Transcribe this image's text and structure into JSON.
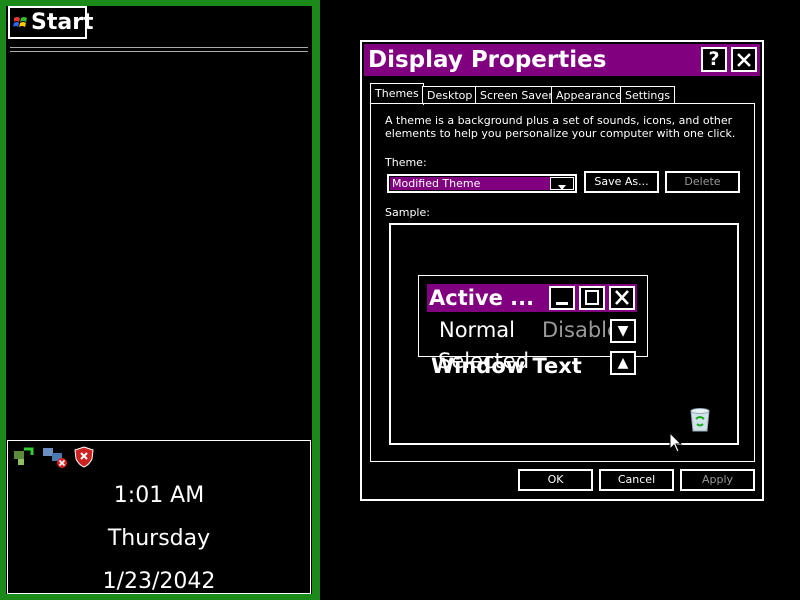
{
  "taskbar": {
    "start_label": "Start",
    "tray_icons": [
      "network-icon",
      "network-disconnected-icon",
      "security-alert-icon"
    ],
    "clock": {
      "time": "1:01 AM",
      "day": "Thursday",
      "date": "1/23/2042"
    }
  },
  "dialog": {
    "title": "Display Properties",
    "help_btn": "?",
    "close_btn": "✕",
    "tabs": [
      {
        "label": "Themes",
        "active": true
      },
      {
        "label": "Desktop"
      },
      {
        "label": "Screen Saver"
      },
      {
        "label": "Appearance"
      },
      {
        "label": "Settings"
      }
    ],
    "description": "A theme is a background plus a set of sounds, icons, and other elements to help you personalize your computer with one click.",
    "theme_label": "Theme:",
    "theme_value": "Modified Theme",
    "save_as": "Save As...",
    "delete": "Delete",
    "sample_label": "Sample:",
    "sample": {
      "active_title": "Active ...",
      "normal": "Normal",
      "disabled": "Disable",
      "selected": "Selected",
      "window_text": "Window Text"
    },
    "ok": "OK",
    "cancel": "Cancel",
    "apply": "Apply"
  },
  "colors": {
    "accent": "#800080",
    "taskbar_border": "#1b8a1b",
    "background": "#000000",
    "foreground": "#ffffff"
  }
}
